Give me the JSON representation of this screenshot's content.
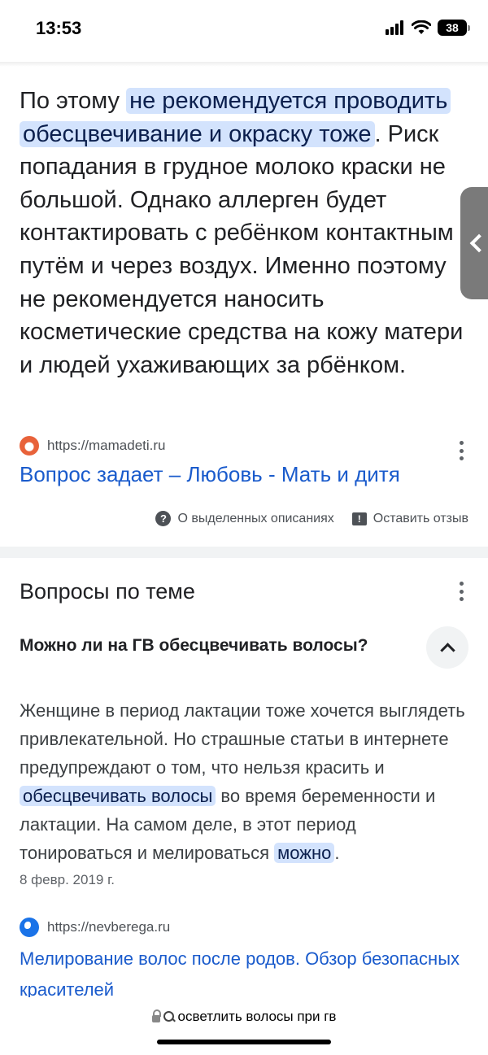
{
  "status_bar": {
    "time": "13:53",
    "battery": "38"
  },
  "snippet": {
    "text_before": "По этому ",
    "highlight": "не рекомендуется проводить обесцвечивание и окраску тоже",
    "text_after": ". Риск попадания в грудное молоко краски не большой. Однако аллерген будет контактировать с ребёнком контактным путём и через воздух. Именно поэтому не рекомендуется наносить косметические средства на кожу матери и людей ухаживающих за рбёнком.",
    "source_url": "https://mamadeti.ru",
    "link_title": "Вопрос задает – Любовь - Мать и дитя",
    "about_label": "О выделенных описаниях",
    "feedback_label": "Оставить отзыв"
  },
  "related": {
    "title": "Вопросы по теме",
    "question": "Можно ли на ГВ обесцвечивать волосы?",
    "answer_part1": "Женщине в период лактации тоже хочется выглядеть привлекательной. Но страшные статьи в интернете предупреждают о том, что нельзя красить и ",
    "answer_highlight1": "обесцвечивать волосы",
    "answer_part2": " во время беременности и лактации. На самом деле, в этот период тонироваться и мелироваться ",
    "answer_highlight2": "можно",
    "answer_part3": ".",
    "date": "8 февр. 2019 г.",
    "source_url": "https://nevberega.ru",
    "link_title": "Мелирование волос после родов. Обзор безопасных красителей"
  },
  "address_bar": {
    "query": "осветлить волосы при гв"
  },
  "icons": {
    "wifi": "wifi-icon",
    "signal": "signal-icon",
    "battery": "battery-icon",
    "help": "help-icon",
    "feedback": "feedback-icon",
    "more": "more-vert-icon",
    "chevron_up": "chevron-up-icon",
    "lock": "lock-icon",
    "search": "search-icon",
    "side_tab": "chevron-left-icon"
  },
  "colors": {
    "link": "#1a5bcc",
    "highlight_bg": "#d3e3fd",
    "text": "#202124"
  }
}
